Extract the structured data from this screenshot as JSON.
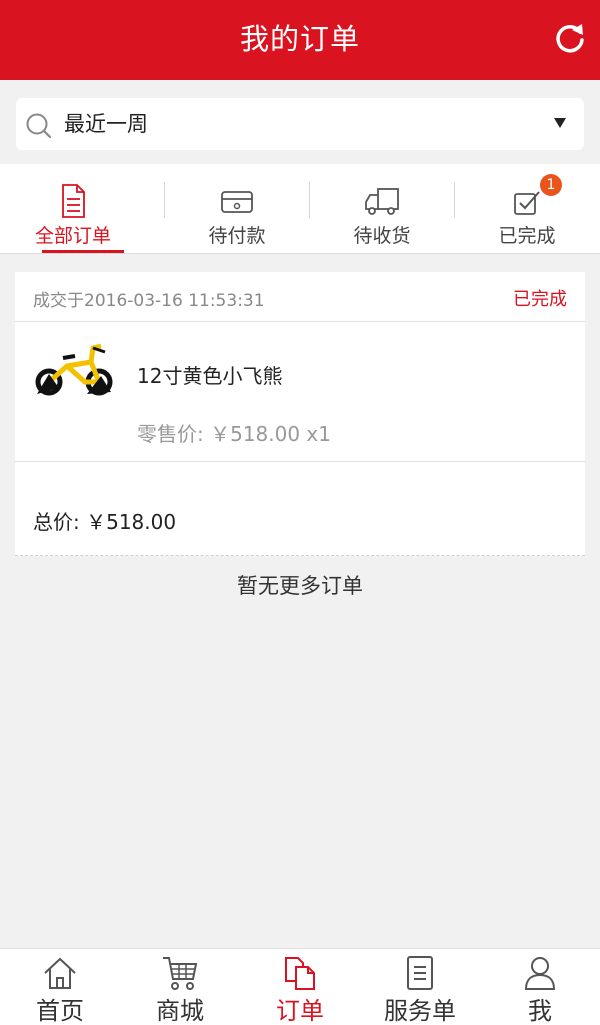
{
  "header": {
    "title": "我的订单",
    "refresh_icon": "refresh-icon"
  },
  "filter": {
    "selected": "最近一周",
    "search_icon": "search-icon",
    "dropdown_icon": "caret-down-icon"
  },
  "tabs": [
    {
      "label": "全部订单",
      "icon": "document-icon",
      "active": true
    },
    {
      "label": "待付款",
      "icon": "card-icon"
    },
    {
      "label": "待收货",
      "icon": "truck-icon"
    },
    {
      "label": "已完成",
      "icon": "checkbox-icon",
      "badge": "1"
    }
  ],
  "order": {
    "date": "成交于2016-03-16 11:53:31",
    "status": "已完成",
    "item_name": "12寸黄色小飞熊",
    "item_price": "零售价: ￥518.00 x1",
    "total": "总价: ￥518.00"
  },
  "no_more": "暂无更多订单",
  "bottom_nav": [
    {
      "label": "首页",
      "icon": "home-icon"
    },
    {
      "label": "商城",
      "icon": "cart-icon"
    },
    {
      "label": "订单",
      "icon": "order-icon",
      "active": true
    },
    {
      "label": "服务单",
      "icon": "service-doc-icon"
    },
    {
      "label": "我",
      "icon": "user-icon"
    }
  ],
  "colors": {
    "brand": "#d9131f",
    "badge": "#e8551c",
    "background": "#f1f1f1"
  }
}
